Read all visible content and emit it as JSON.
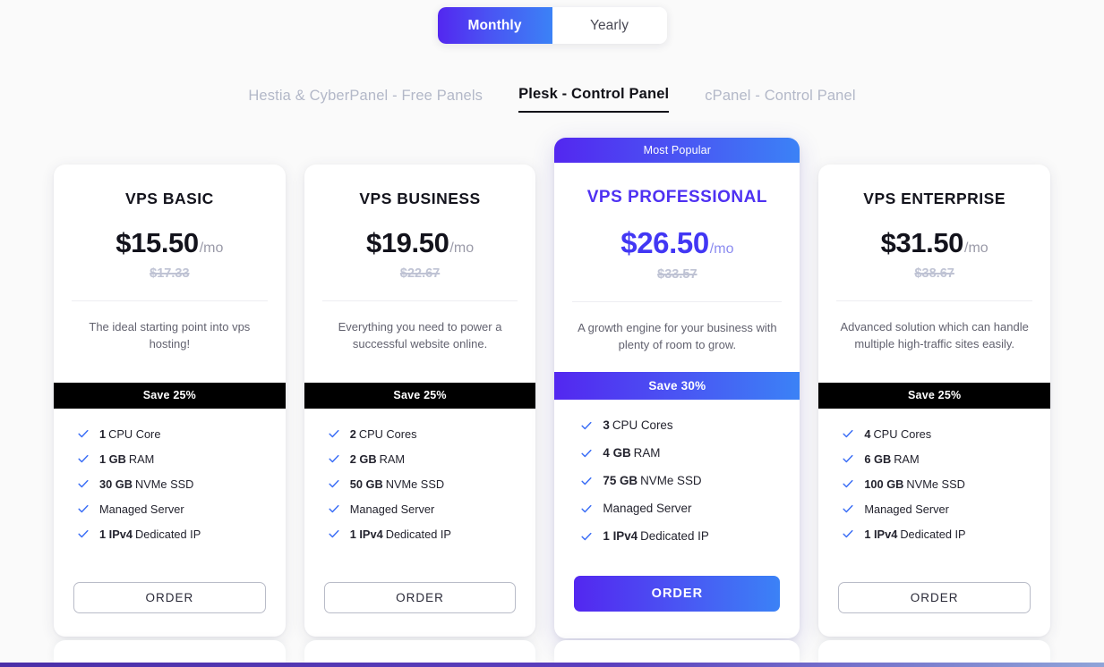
{
  "billing": {
    "options": [
      {
        "label": "Monthly",
        "active": true
      },
      {
        "label": "Yearly",
        "active": false
      }
    ]
  },
  "panel_tabs": [
    {
      "label": "Hestia & CyberPanel - Free Panels",
      "active": false
    },
    {
      "label": "Plesk - Control Panel",
      "active": true
    },
    {
      "label": "cPanel - Control Panel",
      "active": false
    }
  ],
  "colors": {
    "gradient_start": "#5327f0",
    "gradient_mid": "#4a54f3",
    "gradient_end": "#3b82f6",
    "featured_title": "#4e31f2",
    "featured_price": "#4237f4",
    "check": "#3b6ef6",
    "save_banner": "#000000",
    "background": "#fafafa",
    "bottom_bar": "#4b2fa8"
  },
  "icons": {
    "check": "check-icon"
  },
  "plans": [
    {
      "name": "VPS BASIC",
      "featured": false,
      "badge": "",
      "price": "$15.50",
      "period": "/mo",
      "old_price": "$17.33",
      "tagline": "The ideal starting point into vps hosting!",
      "save": "Save 25%",
      "features": [
        {
          "strong": "1",
          "rest": "CPU Core"
        },
        {
          "strong": "1 GB",
          "rest": "RAM"
        },
        {
          "strong": "30 GB",
          "rest": "NVMe SSD"
        },
        {
          "strong": "",
          "rest": "Managed Server"
        },
        {
          "strong": "1 IPv4",
          "rest": "Dedicated IP"
        }
      ],
      "order_label": "ORDER"
    },
    {
      "name": "VPS BUSINESS",
      "featured": false,
      "badge": "",
      "price": "$19.50",
      "period": "/mo",
      "old_price": "$22.67",
      "tagline": "Everything you need to power a successful website online.",
      "save": "Save 25%",
      "features": [
        {
          "strong": "2",
          "rest": "CPU Cores"
        },
        {
          "strong": "2 GB",
          "rest": "RAM"
        },
        {
          "strong": "50 GB",
          "rest": "NVMe SSD"
        },
        {
          "strong": "",
          "rest": "Managed Server"
        },
        {
          "strong": "1 IPv4",
          "rest": "Dedicated IP"
        }
      ],
      "order_label": "ORDER"
    },
    {
      "name": "VPS PROFESSIONAL",
      "featured": true,
      "badge": "Most Popular",
      "price": "$26.50",
      "period": "/mo",
      "old_price": "$33.57",
      "tagline": "A growth engine for your business with plenty of room to grow.",
      "save": "Save 30%",
      "features": [
        {
          "strong": "3",
          "rest": "CPU Cores"
        },
        {
          "strong": "4 GB",
          "rest": "RAM"
        },
        {
          "strong": "75 GB",
          "rest": "NVMe SSD"
        },
        {
          "strong": "",
          "rest": "Managed Server"
        },
        {
          "strong": "1 IPv4",
          "rest": "Dedicated IP"
        }
      ],
      "order_label": "ORDER"
    },
    {
      "name": "VPS ENTERPRISE",
      "featured": false,
      "badge": "",
      "price": "$31.50",
      "period": "/mo",
      "old_price": "$38.67",
      "tagline": "Advanced solution which can handle multiple high-traffic sites easily.",
      "save": "Save 25%",
      "features": [
        {
          "strong": "4",
          "rest": "CPU Cores"
        },
        {
          "strong": "6 GB",
          "rest": "RAM"
        },
        {
          "strong": "100 GB",
          "rest": "NVMe SSD"
        },
        {
          "strong": "",
          "rest": "Managed Server"
        },
        {
          "strong": "1 IPv4",
          "rest": "Dedicated IP"
        }
      ],
      "order_label": "ORDER"
    }
  ]
}
